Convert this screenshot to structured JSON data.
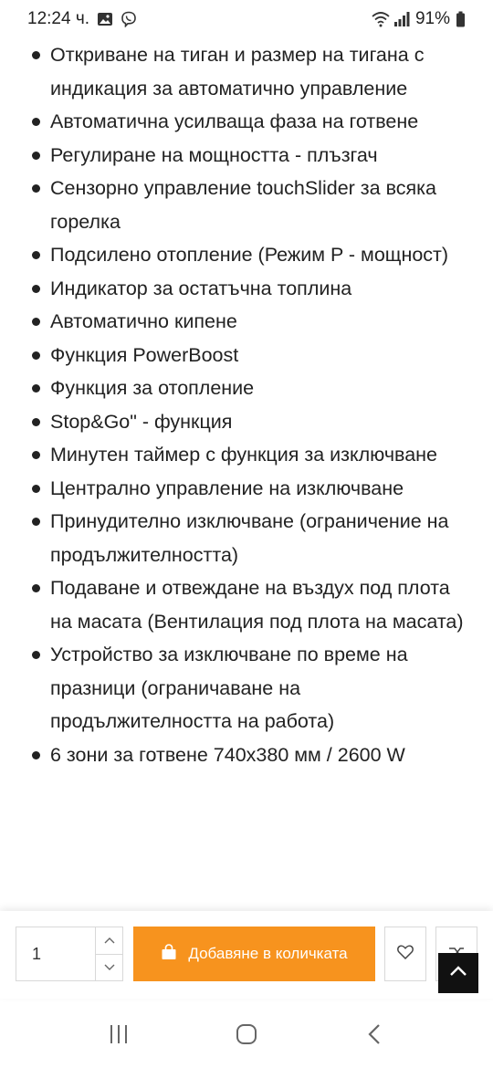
{
  "status_bar": {
    "time": "12:24 ч.",
    "battery": "91%",
    "icons": [
      "gallery-icon",
      "viber-icon",
      "wifi-icon",
      "signal-icon",
      "battery-icon"
    ]
  },
  "features": [
    "Откриване на тиган и размер на тигана с индикация за автоматично управление",
    "Автоматична усилваща фаза на готвене",
    "Регулиране на мощността - плъзгач",
    "Сензорно управление touchSlider за всяка горелка",
    "Подсилено отопление (Режим P - мощност)",
    "Индикатор за остатъчна топлина",
    "Автоматично кипене",
    "Функция PowerBoost",
    "Функция за отопление",
    "Stop&Go\" - функция",
    "Минутен таймер с функция за изключване",
    "Централно управление на изключване",
    "Принудително изключване (ограничение на продължителността)",
    "Подаване и отвеждане на въздух под плота на масата (Вентилация под плота на масата)",
    "Устройство за изключване по време на празници (ограничаване на продължителността на работа)",
    "6 зони за готвене 740x380 мм / 2600 W"
  ],
  "purchase_bar": {
    "quantity": "1",
    "add_to_cart_label": "Добавяне в количката",
    "accent_color": "#f7931e"
  },
  "navigation": {
    "icons": [
      "recent-apps-icon",
      "home-icon",
      "back-icon"
    ]
  }
}
